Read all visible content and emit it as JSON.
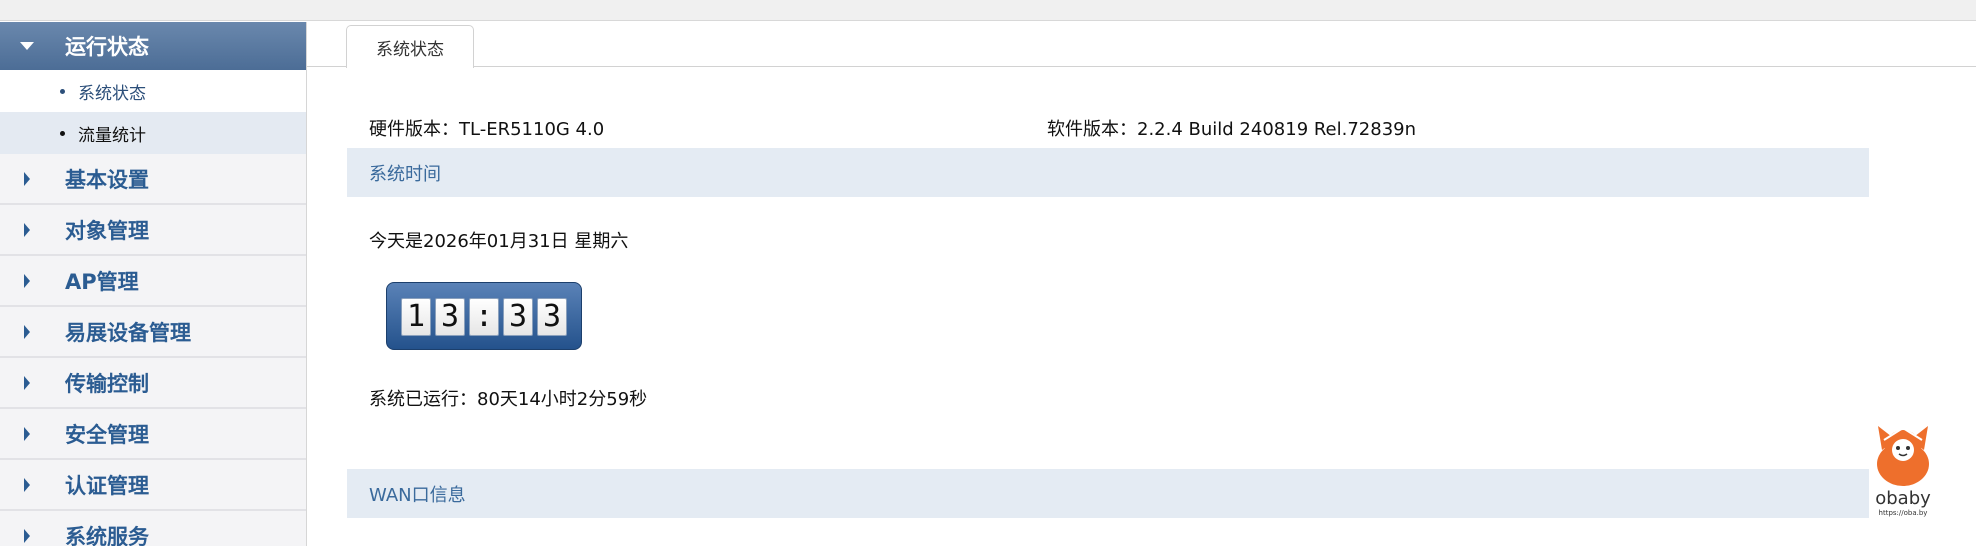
{
  "sidebar": {
    "active_group": "运行状态",
    "sub_items": [
      "系统状态",
      "流量统计"
    ],
    "groups": [
      "基本设置",
      "对象管理",
      "AP管理",
      "易展设备管理",
      "传输控制",
      "安全管理",
      "认证管理",
      "系统服务"
    ]
  },
  "tab": {
    "label": "系统状态"
  },
  "info": {
    "hardware": "硬件版本：TL-ER5110G 4.0",
    "software": "软件版本：2.2.4 Build 240819 Rel.72839n"
  },
  "time_section": {
    "title": "系统时间",
    "date_text": "今天是2026年01月31日 星期六",
    "clock": {
      "h1": "1",
      "h2": "3",
      "sep": ":",
      "m1": "3",
      "m2": "3"
    },
    "uptime": "系统已运行：80天14小时2分59秒"
  },
  "wan_section": {
    "title": "WAN口信息"
  },
  "watermark": {
    "brand": "obaby",
    "url": "https://oba.by"
  },
  "colors": {
    "accent": "#4c6d96",
    "link_blue": "#2b5c92",
    "section_bg": "#e4ebf3",
    "mascot_orange": "#ee6f2c"
  }
}
